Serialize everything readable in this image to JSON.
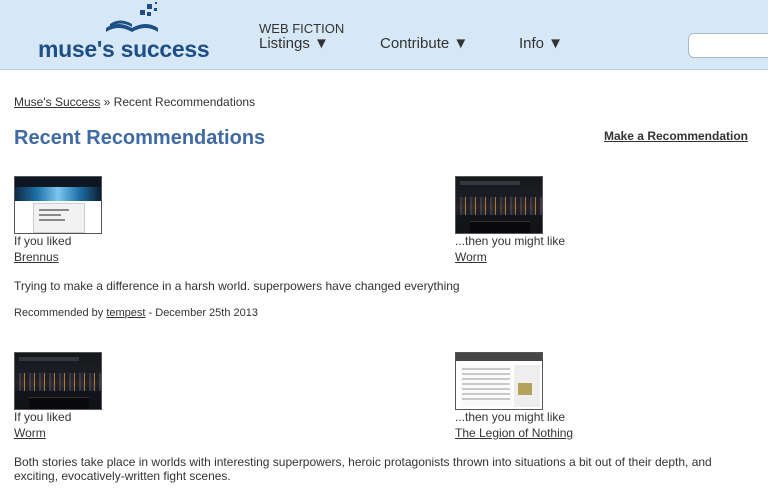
{
  "header": {
    "logo_text": "muse's success",
    "nav_label": "WEB FICTION",
    "nav": [
      {
        "label": "Listings ▼"
      },
      {
        "label": "Contribute ▼"
      },
      {
        "label": "Info ▼"
      }
    ],
    "search": {
      "value": "",
      "placeholder": ""
    }
  },
  "breadcrumb": {
    "home": "Muse's Success",
    "separator": " » ",
    "current": "Recent Recommendations"
  },
  "page_title": "Recent Recommendations",
  "make_recommendation": "Make a Recommendation",
  "recommendations": [
    {
      "liked_prefix": "If you liked",
      "liked_story": "Brennus",
      "might_prefix": "...then you might like",
      "might_story": "Worm",
      "description": "Trying to make a difference in a harsh world. superpowers have changed everything",
      "recommended_by_prefix": "Recommended by ",
      "recommender": "tempest",
      "date": " - December 25th 2013"
    },
    {
      "liked_prefix": "If you liked",
      "liked_story": "Worm",
      "might_prefix": "...then you might like",
      "might_story": "The Legion of Nothing",
      "description": "Both stories take place in worlds with interesting superpowers, heroic protagonists thrown into situations a bit out of their depth, and exciting, evocatively-written fight scenes.",
      "recommended_by_prefix": "",
      "recommender": "",
      "date": ""
    }
  ],
  "colors": {
    "header_bg": "#d6e8f6",
    "brand": "#1d4f86",
    "title": "#3f6aa3"
  }
}
